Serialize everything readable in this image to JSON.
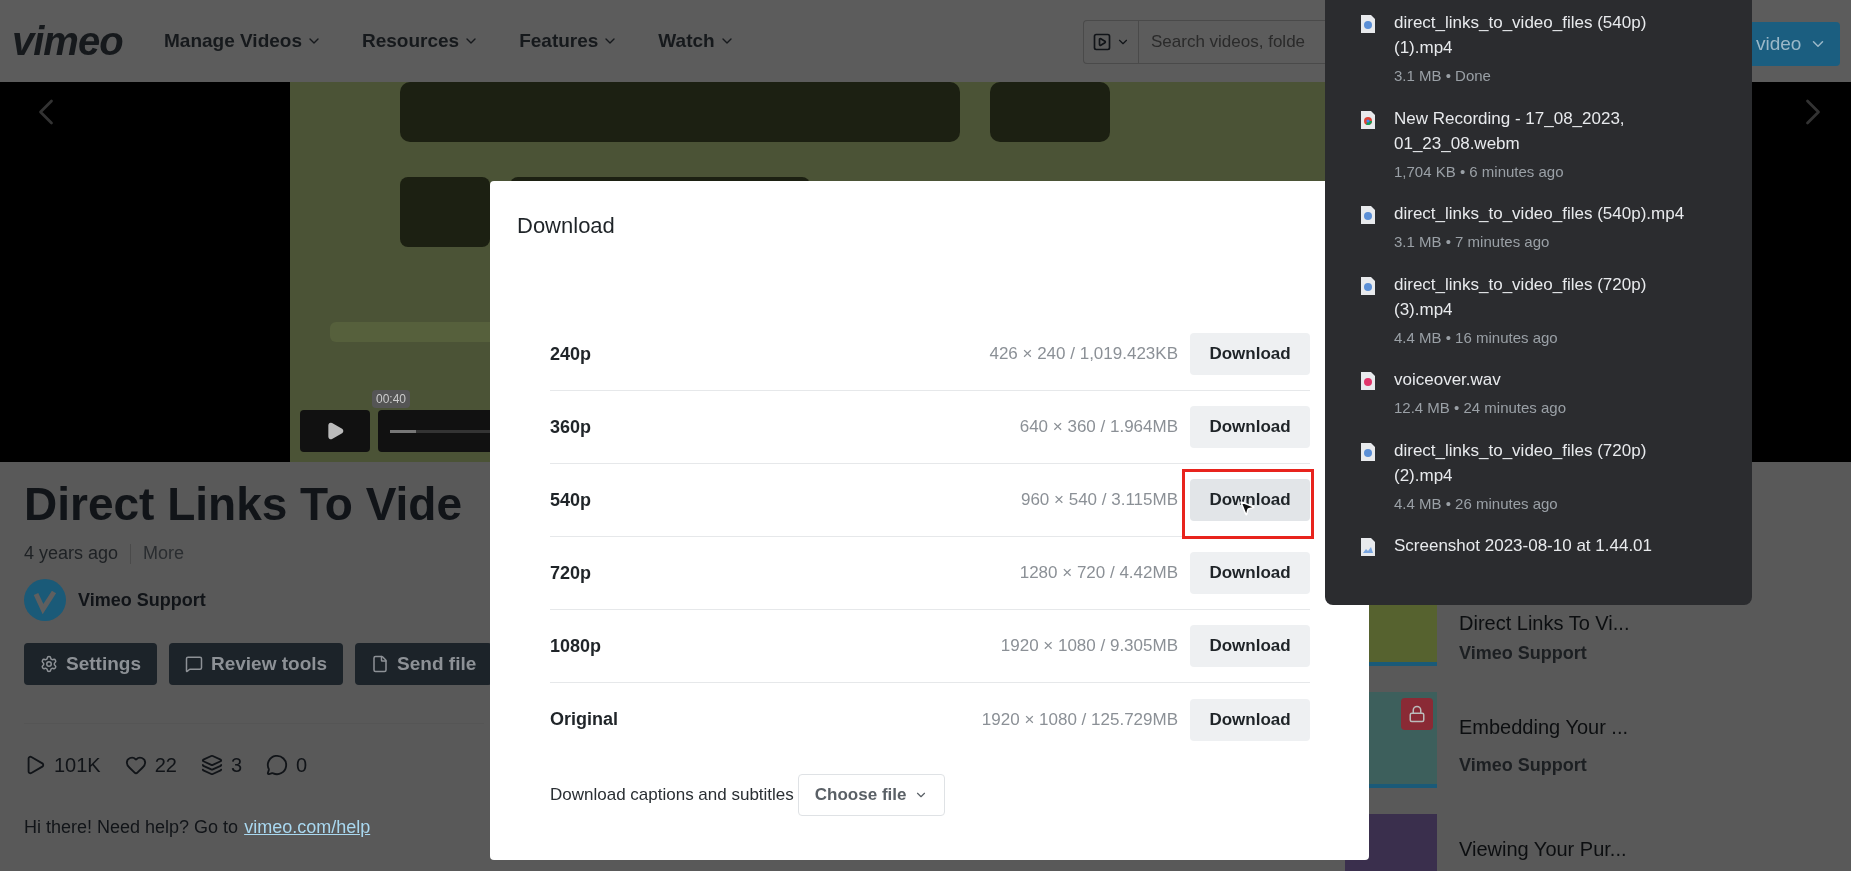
{
  "nav": {
    "logo": "vimeo",
    "items": [
      {
        "label": "Manage Videos"
      },
      {
        "label": "Resources"
      },
      {
        "label": "Features"
      },
      {
        "label": "Watch"
      }
    ],
    "search": {
      "placeholder": "Search videos, folde"
    },
    "new_button": "video"
  },
  "player": {
    "time_tooltip": "00:40",
    "progress": {
      "level": 0.15
    }
  },
  "video": {
    "title": "Direct Links To Vide",
    "age": "4 years ago",
    "more": "More",
    "owner": "Vimeo Support",
    "actions": [
      {
        "label": "Settings",
        "kind": "settings"
      },
      {
        "label": "Review tools",
        "kind": "review"
      },
      {
        "label": "Send file",
        "kind": "send"
      }
    ],
    "stats": [
      {
        "kind": "plays",
        "value": "101K"
      },
      {
        "kind": "likes",
        "value": "22"
      },
      {
        "kind": "collections",
        "value": "3"
      },
      {
        "kind": "comments",
        "value": "0"
      }
    ],
    "description": "Hi there! Need help? Go to",
    "link": "vimeo.com/help"
  },
  "related": [
    {
      "title": "Direct Links To Vi...",
      "owner": "Vimeo Support",
      "color": "#56622f",
      "locked": false
    },
    {
      "title": "Embedding Your ...",
      "owner": "Vimeo Support",
      "color": "#3d5f5c",
      "locked": true
    },
    {
      "title": "Viewing Your Pur...",
      "color": "#3a2f4d",
      "locked": false
    }
  ],
  "modal": {
    "title": "Download",
    "rows": [
      {
        "label": "240p",
        "info": "426 × 240 / 1,019.423KB",
        "button": "Download",
        "highlighted": false
      },
      {
        "label": "360p",
        "info": "640 × 360 / 1.964MB",
        "button": "Download",
        "highlighted": false
      },
      {
        "label": "540p",
        "info": "960 × 540 / 3.115MB",
        "button": "Download",
        "highlighted": true
      },
      {
        "label": "720p",
        "info": "1280 × 720 / 4.42MB",
        "button": "Download",
        "highlighted": false
      },
      {
        "label": "1080p",
        "info": "1920 × 1080 / 9.305MB",
        "button": "Download",
        "highlighted": false
      },
      {
        "label": "Original",
        "info": "1920 × 1080 / 125.729MB",
        "button": "Download",
        "highlighted": false
      }
    ],
    "captions_label": "Download captions and subtitles",
    "captions_select": "Choose file"
  },
  "downloads": [
    {
      "name": "direct_links_to_video_files (540p) (1).mp4",
      "meta": "3.1 MB • Done",
      "kind": "video"
    },
    {
      "name": "New Recording - 17_08_2023, 01_23_08.webm",
      "meta": "1,704 KB • 6 minutes ago",
      "kind": "recording"
    },
    {
      "name": "direct_links_to_video_files (540p).mp4",
      "meta": "3.1 MB • 7 minutes ago",
      "kind": "video"
    },
    {
      "name": "direct_links_to_video_files (720p) (3).mp4",
      "meta": "4.4 MB • 16 minutes ago",
      "kind": "video"
    },
    {
      "name": "voiceover.wav",
      "meta": "12.4 MB • 24 minutes ago",
      "kind": "audio"
    },
    {
      "name": "direct_links_to_video_files (720p) (2).mp4",
      "meta": "4.4 MB • 26 minutes ago",
      "kind": "video"
    },
    {
      "name": "Screenshot 2023-08-10 at 1.44.01"
    }
  ]
}
